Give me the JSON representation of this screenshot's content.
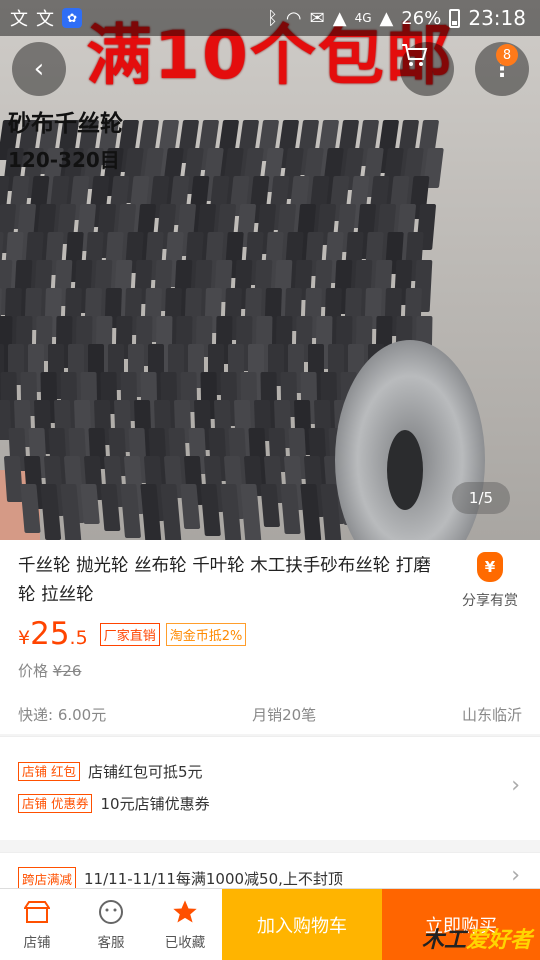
{
  "status_bar": {
    "left_icons": [
      "文",
      "文"
    ],
    "battery": "26%",
    "time": "23:18",
    "network": "4G"
  },
  "hero": {
    "banner": "满10个包邮",
    "caption_line1": "砂布千丝轮",
    "caption_line2": "120-320目",
    "page_indicator": "1/5",
    "cart_badge": "8"
  },
  "product": {
    "title": "千丝轮 抛光轮 丝布轮 千叶轮 木工扶手砂布丝轮 打磨轮 拉丝轮",
    "share_label": "分享有赏",
    "share_icon_text": "¥",
    "price_symbol": "¥",
    "price_int": "25",
    "price_dec": ".5",
    "tag_factory": "厂家直销",
    "tag_coin": "淘金币抵2%",
    "orig_label": "价格",
    "orig_price": "¥26",
    "shipping": "快递: 6.00元",
    "monthly_sales": "月销20笔",
    "location": "山东临沂"
  },
  "promos": [
    {
      "tag": "店铺 红包",
      "text": "店铺红包可抵5元"
    },
    {
      "tag": "店铺 优惠券",
      "text": "10元店铺优惠券"
    }
  ],
  "cross_store": {
    "tag": "跨店满减",
    "text": "11/11-11/11每满1000减50,上不封顶"
  },
  "bottom_bar": {
    "shop": "店铺",
    "service": "客服",
    "favorited": "已收藏",
    "add_to_cart": "加入购物车",
    "buy_now": "立即购买",
    "watermark_a": "木工",
    "watermark_b": "爱好者"
  },
  "colors": {
    "accent": "#ff5000",
    "cart_button": "#ffb400",
    "buy_button": "#ff6500"
  }
}
